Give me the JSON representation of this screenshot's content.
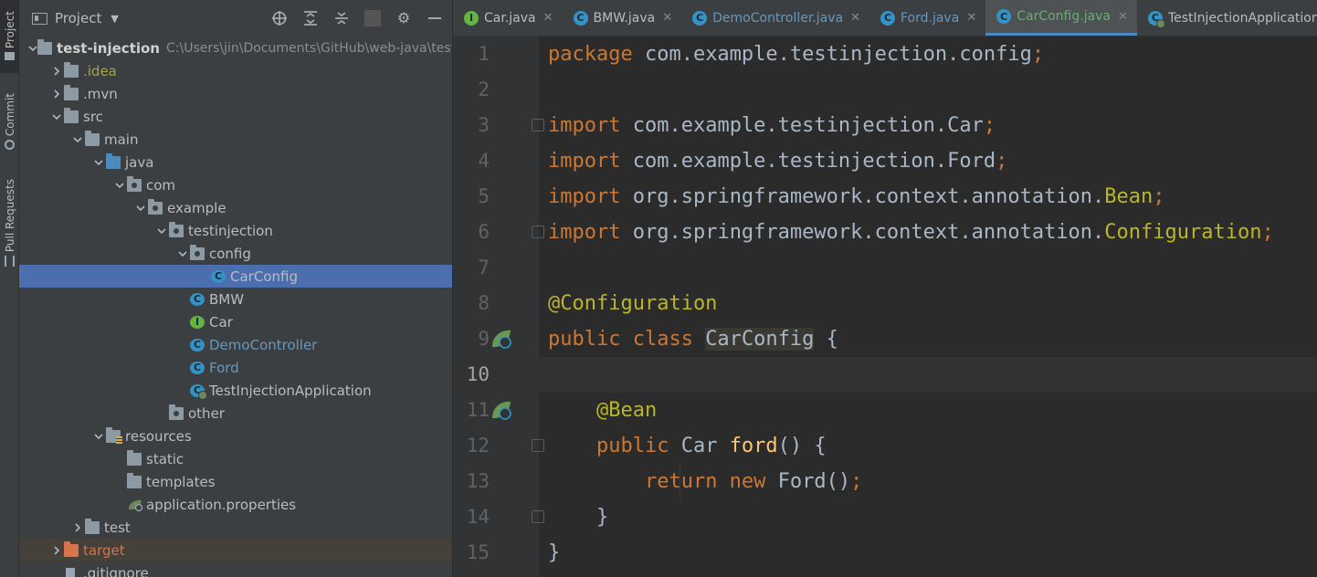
{
  "toolstrip": {
    "tabs": [
      {
        "label": "Project",
        "active": true
      },
      {
        "label": "Commit",
        "active": false
      },
      {
        "label": "Pull Requests",
        "active": false
      }
    ]
  },
  "project_panel": {
    "title": "Project",
    "header_icons": [
      "locate-icon",
      "expand-all-icon",
      "collapse-all-icon",
      "gear-icon",
      "minimize-icon"
    ],
    "tree": [
      {
        "label": "test-injection",
        "path": "C:\\Users\\jin\\Documents\\GitHub\\web-java\\test-i",
        "depth": 0,
        "arrow": "down",
        "icon": "folder",
        "style": "bold"
      },
      {
        "label": ".idea",
        "depth": 1,
        "arrow": "right",
        "icon": "folder",
        "style": "idea"
      },
      {
        "label": ".mvn",
        "depth": 1,
        "arrow": "right",
        "icon": "folder"
      },
      {
        "label": "src",
        "depth": 1,
        "arrow": "down",
        "icon": "folder"
      },
      {
        "label": "main",
        "depth": 2,
        "arrow": "down",
        "icon": "folder"
      },
      {
        "label": "java",
        "depth": 3,
        "arrow": "down",
        "icon": "folder-blue"
      },
      {
        "label": "com",
        "depth": 4,
        "arrow": "down",
        "icon": "package"
      },
      {
        "label": "example",
        "depth": 5,
        "arrow": "down",
        "icon": "package"
      },
      {
        "label": "testinjection",
        "depth": 6,
        "arrow": "down",
        "icon": "package"
      },
      {
        "label": "config",
        "depth": 7,
        "arrow": "down",
        "icon": "package"
      },
      {
        "label": "CarConfig",
        "depth": 8,
        "arrow": "",
        "icon": "class",
        "selected": true
      },
      {
        "label": "BMW",
        "depth": 7,
        "arrow": "",
        "icon": "class"
      },
      {
        "label": "Car",
        "depth": 7,
        "arrow": "",
        "icon": "interface"
      },
      {
        "label": "DemoController",
        "depth": 7,
        "arrow": "",
        "icon": "class",
        "style": "blueish"
      },
      {
        "label": "Ford",
        "depth": 7,
        "arrow": "",
        "icon": "class",
        "style": "blueish"
      },
      {
        "label": "TestInjectionApplication",
        "depth": 7,
        "arrow": "",
        "icon": "boot-class"
      },
      {
        "label": "other",
        "depth": 6,
        "arrow": "",
        "icon": "package"
      },
      {
        "label": "resources",
        "depth": 3,
        "arrow": "down",
        "icon": "resources"
      },
      {
        "label": "static",
        "depth": 4,
        "arrow": "",
        "icon": "folder"
      },
      {
        "label": "templates",
        "depth": 4,
        "arrow": "",
        "icon": "folder"
      },
      {
        "label": "application.properties",
        "depth": 4,
        "arrow": "",
        "icon": "properties"
      },
      {
        "label": "test",
        "depth": 2,
        "arrow": "right",
        "icon": "folder"
      },
      {
        "label": "target",
        "depth": 1,
        "arrow": "right",
        "icon": "folder-orange",
        "style": "orange",
        "excluded": true
      },
      {
        "label": ".gitignore",
        "depth": 1,
        "arrow": "",
        "icon": "file"
      }
    ]
  },
  "editor": {
    "tabs": [
      {
        "label": "Car.java",
        "icon": "interface",
        "style": "plain",
        "active": false
      },
      {
        "label": "BMW.java",
        "icon": "class",
        "style": "plain",
        "active": false
      },
      {
        "label": "DemoController.java",
        "icon": "class",
        "style": "blue",
        "active": false
      },
      {
        "label": "Ford.java",
        "icon": "class",
        "style": "blue",
        "active": false
      },
      {
        "label": "CarConfig.java",
        "icon": "class",
        "style": "greenblue",
        "active": true
      },
      {
        "label": "TestInjectionApplication.java",
        "icon": "boot-class",
        "style": "plain",
        "active": false
      }
    ],
    "current_line": 10,
    "lines": [
      {
        "n": "1",
        "tokens": [
          [
            "kw",
            "package"
          ],
          [
            "",
            " com.example.testinjection.config"
          ],
          [
            "kw",
            ";"
          ]
        ]
      },
      {
        "n": "2",
        "tokens": []
      },
      {
        "n": "3",
        "tokens": [
          [
            "kw",
            "import"
          ],
          [
            "",
            " com.example.testinjection.Car"
          ],
          [
            "kw",
            ";"
          ]
        ]
      },
      {
        "n": "4",
        "tokens": [
          [
            "kw",
            "import"
          ],
          [
            "",
            " com.example.testinjection.Ford"
          ],
          [
            "kw",
            ";"
          ]
        ]
      },
      {
        "n": "5",
        "tokens": [
          [
            "kw",
            "import"
          ],
          [
            "",
            " org.springframework.context.annotation."
          ],
          [
            "ann",
            "Bean"
          ],
          [
            "kw",
            ";"
          ]
        ]
      },
      {
        "n": "6",
        "tokens": [
          [
            "kw",
            "import"
          ],
          [
            "",
            " org.springframework.context.annotation."
          ],
          [
            "ann",
            "Configuration"
          ],
          [
            "kw",
            ";"
          ]
        ]
      },
      {
        "n": "7",
        "tokens": []
      },
      {
        "n": "8",
        "tokens": [
          [
            "ann",
            "@Configuration"
          ]
        ]
      },
      {
        "n": "9",
        "tokens": [
          [
            "kw",
            "public class "
          ],
          [
            "hl",
            "CarConfig"
          ],
          [
            "",
            " {"
          ]
        ]
      },
      {
        "n": "10",
        "tokens": []
      },
      {
        "n": "11",
        "tokens": [
          [
            "",
            "    "
          ],
          [
            "ann",
            "@Bean"
          ]
        ]
      },
      {
        "n": "12",
        "tokens": [
          [
            "",
            "    "
          ],
          [
            "kw",
            "public "
          ],
          [
            "",
            "Car "
          ],
          [
            "fn",
            "ford"
          ],
          [
            "",
            "() {"
          ]
        ]
      },
      {
        "n": "13",
        "tokens": [
          [
            "",
            "        "
          ],
          [
            "kw",
            "return new "
          ],
          [
            "",
            "Ford()"
          ],
          [
            "kw",
            ";"
          ]
        ]
      },
      {
        "n": "14",
        "tokens": [
          [
            "",
            "    }"
          ]
        ]
      },
      {
        "n": "15",
        "tokens": [
          [
            "",
            "}"
          ]
        ]
      }
    ]
  }
}
